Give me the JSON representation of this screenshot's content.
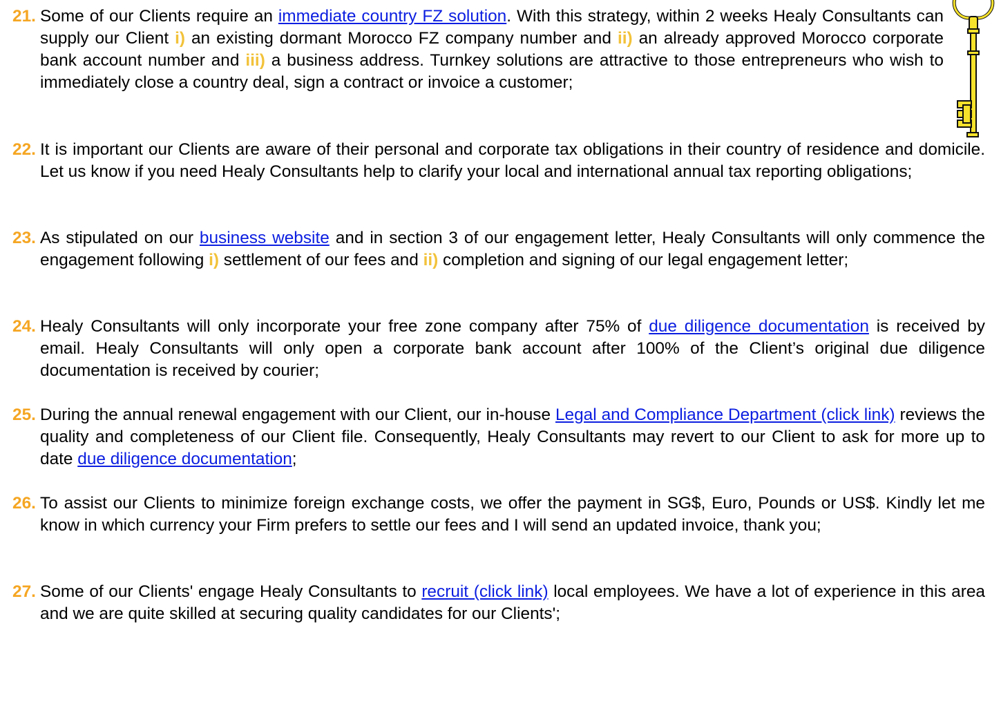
{
  "colors": {
    "number": "#f5a623",
    "roman": "#f2c23a",
    "link": "#0b1ee0",
    "key": "#f7e22b"
  },
  "items": [
    {
      "num": "21.",
      "parts": [
        {
          "t": "Some of our Clients require an "
        },
        {
          "t": "immediate country FZ solution",
          "link": true
        },
        {
          "t": ". With this strategy, within 2 weeks Healy Consultants can supply our Client "
        },
        {
          "t": "i)",
          "hl": true
        },
        {
          "t": " an existing dormant Morocco FZ company number and "
        },
        {
          "t": "ii)",
          "hl": true
        },
        {
          "t": " an already approved Morocco corporate bank account number and "
        },
        {
          "t": "iii)",
          "hl": true
        },
        {
          "t": " a business address. Turnkey solutions are attractive to those entrepreneurs who wish to immediately close a country deal, sign a contract or invoice a customer;"
        }
      ]
    },
    {
      "num": "22.",
      "parts": [
        {
          "t": "It is important our Clients are aware of their personal and corporate tax obligations in their country of residence and domicile. Let us know if you need Healy Consultants help to clarify your local and international annual tax reporting obligations;"
        }
      ]
    },
    {
      "num": "23.",
      "parts": [
        {
          "t": "As stipulated on our "
        },
        {
          "t": "business website",
          "link": true
        },
        {
          "t": " and in section 3 of our engagement letter, Healy Consultants will only commence the engagement following "
        },
        {
          "t": "i)",
          "hl": true
        },
        {
          "t": " settlement of our fees and "
        },
        {
          "t": "ii)",
          "hl": true
        },
        {
          "t": " completion and signing of our legal engagement letter;"
        }
      ]
    },
    {
      "num": "24.",
      "parts": [
        {
          "t": "Healy Consultants will only incorporate your free zone company after 75% of "
        },
        {
          "t": "due diligence documentation",
          "link": true
        },
        {
          "t": " is received by email. Healy Consultants will only open a corporate bank account after 100% of the Client’s original due diligence documentation is received by courier;"
        }
      ]
    },
    {
      "num": "25.",
      "parts": [
        {
          "t": "During the annual renewal engagement with our Client, our in-house "
        },
        {
          "t": "Legal and Compliance Department (click link)",
          "link": true
        },
        {
          "t": " reviews the quality and completeness of our Client file. Consequently, Healy Consultants may revert to our Client to ask for more up to date "
        },
        {
          "t": "due diligence documentation",
          "link": true
        },
        {
          "t": ";"
        }
      ]
    },
    {
      "num": "26.",
      "parts": [
        {
          "t": "To assist our Clients to minimize foreign exchange costs, we offer the payment in SG$, Euro, Pounds or US$. Kindly let me know in which currency your Firm prefers to settle our fees and I will send an updated invoice, thank you;"
        }
      ]
    },
    {
      "num": "27.",
      "parts": [
        {
          "t": "Some of our Clients' engage Healy Consultants to "
        },
        {
          "t": "recruit (click link)",
          "link": true
        },
        {
          "t": " local employees. We have a lot of experience in this area and we are quite skilled at securing quality candidates for our Clients';"
        }
      ]
    }
  ]
}
